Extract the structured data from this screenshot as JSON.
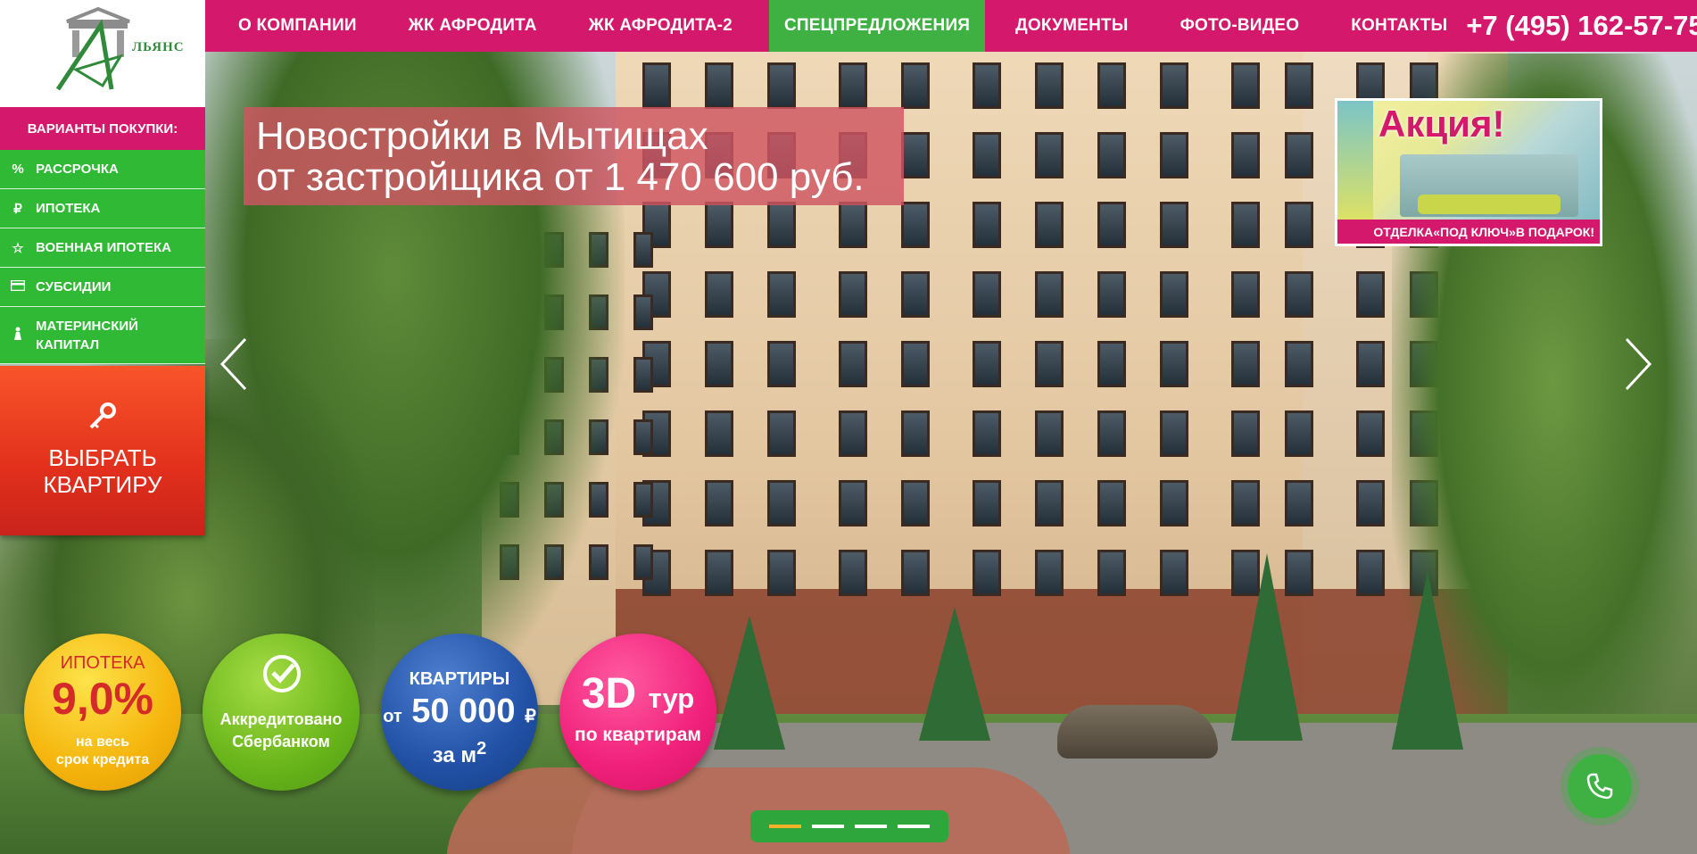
{
  "brand": {
    "logo_text": "ЛЬЯНС"
  },
  "nav": {
    "items": [
      {
        "label": "О КОМПАНИИ"
      },
      {
        "label": "ЖК АФРОДИТА"
      },
      {
        "label": "ЖК АФРОДИТА-2"
      },
      {
        "label": "СПЕЦПРЕДЛОЖЕНИЯ",
        "active": true
      },
      {
        "label": "ДОКУМЕНТЫ"
      },
      {
        "label": "ФОТО-ВИДЕО"
      },
      {
        "label": "КОНТАКТЫ"
      }
    ],
    "phone": "+7 (495) 162-57-75"
  },
  "sidebar": {
    "heading": "ВАРИАНТЫ ПОКУПКИ:",
    "items": [
      {
        "label": "РАССРОЧКА",
        "icon": "percent-icon"
      },
      {
        "label": "ИПОТЕКА",
        "icon": "ruble-icon"
      },
      {
        "label": "ВОЕННАЯ ИПОТЕКА",
        "icon": "star-icon"
      },
      {
        "label": "СУБСИДИИ",
        "icon": "card-icon"
      },
      {
        "label": "МАТЕРИНСКИЙ",
        "label2": "КАПИТАЛ",
        "icon": "mother-icon"
      }
    ],
    "choose": {
      "line1": "ВЫБРАТЬ",
      "line2": "КВАРТИРУ",
      "icon": "key-icon"
    }
  },
  "hero": {
    "headline_line1": "Новостройки в Мытищах",
    "headline_line2": "от застройщика от 1 470 600 руб."
  },
  "promo": {
    "title": "Акция!",
    "caption": "ОТДЕЛКА«ПОД КЛЮЧ»В ПОДАРОК!"
  },
  "badges": {
    "mortgage": {
      "line1": "ИПОТЕКА",
      "rate": "9,0%",
      "line3": "на весь",
      "line4": "срок кредита"
    },
    "sber": {
      "line1": "Аккредитовано",
      "line2": "Сбербанком",
      "icon": "sberbank-icon"
    },
    "price": {
      "line1": "КВАРТИРЫ",
      "prefix": "от",
      "amount": "50 000",
      "currency": "₽",
      "line3": "за м",
      "sup": "2"
    },
    "tour": {
      "big": "3D",
      "small": "тур",
      "line2": "по квартирам"
    }
  },
  "slider": {
    "count": 4,
    "active_index": 0
  },
  "colors": {
    "brand_pink": "#d4196d",
    "brand_green": "#2fb934",
    "cta_red": "#e2301c",
    "pager_active": "#f0b32a"
  }
}
